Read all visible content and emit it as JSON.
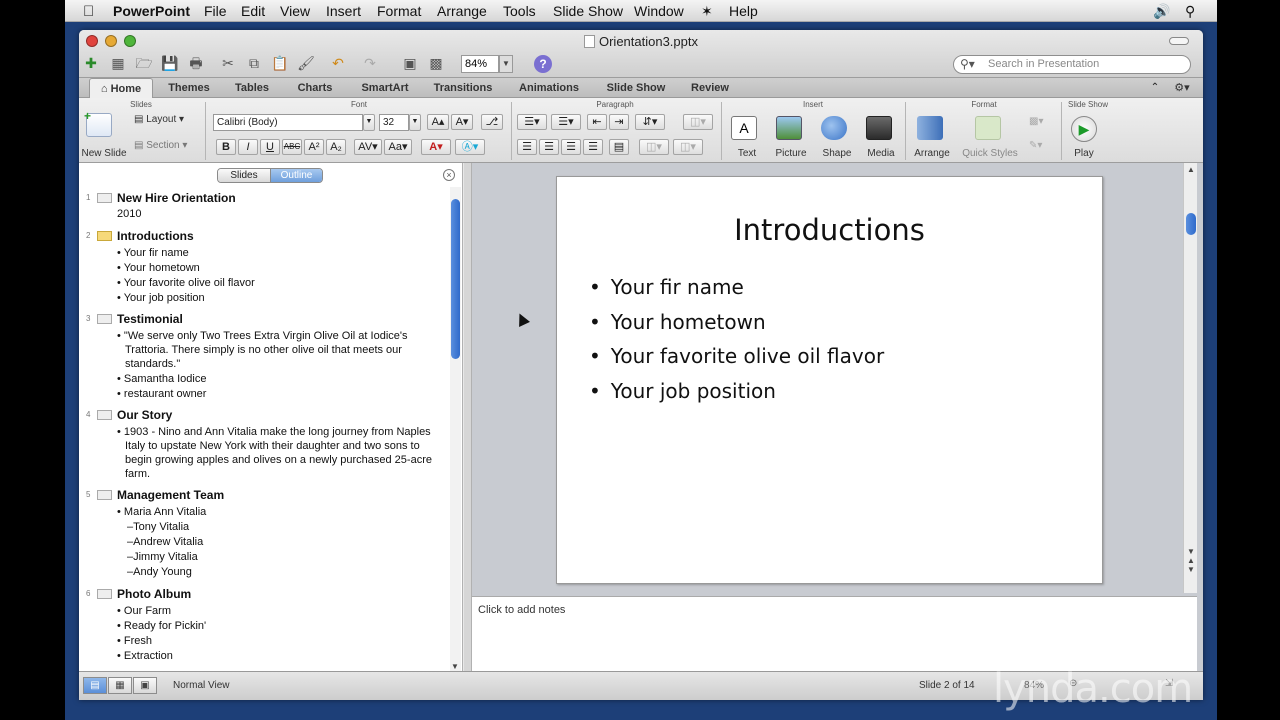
{
  "menubar": {
    "apple": "",
    "app_name": "PowerPoint",
    "items": [
      "File",
      "Edit",
      "View",
      "Insert",
      "Format",
      "Arrange",
      "Tools",
      "Slide Show",
      "Window",
      "Help"
    ]
  },
  "window": {
    "title": "Orientation3.pptx",
    "zoom": "84%",
    "search_placeholder": "Search in Presentation"
  },
  "tabs": [
    "Home",
    "Themes",
    "Tables",
    "Charts",
    "SmartArt",
    "Transitions",
    "Animations",
    "Slide Show",
    "Review"
  ],
  "ribbon": {
    "groups": {
      "slides": "Slides",
      "font": "Font",
      "paragraph": "Paragraph",
      "insert": "Insert",
      "format": "Format",
      "slideshow": "Slide Show"
    },
    "new_slide": "New Slide",
    "layout": "Layout",
    "section": "Section",
    "font_name": "Calibri (Body)",
    "font_size": "32",
    "text": "Text",
    "picture": "Picture",
    "shape": "Shape",
    "media": "Media",
    "arrange": "Arrange",
    "quick_styles": "Quick Styles",
    "play": "Play"
  },
  "pane": {
    "seg_slides": "Slides",
    "seg_outline": "Outline"
  },
  "outline": [
    {
      "num": "1",
      "title": "New Hire Orientation",
      "lines": [
        "2010"
      ],
      "bullets": []
    },
    {
      "num": "2",
      "title": "Introductions",
      "lines": [],
      "bullets": [
        "Your fir name",
        "Your hometown",
        "Your favorite olive oil flavor",
        "Your job position"
      ]
    },
    {
      "num": "3",
      "title": "Testimonial",
      "lines": [],
      "bullets": [
        "\"We serve only Two Trees Extra Virgin Olive Oil at Iodice's Trattoria. There simply is no other olive oil that meets our standards.\"",
        "Samantha Iodice",
        "restaurant owner"
      ]
    },
    {
      "num": "4",
      "title": "Our Story",
      "lines": [],
      "bullets": [
        "1903 - Nino and Ann Vitalia make the long journey from Naples Italy to upstate New York with their daughter and two sons to begin growing apples and olives on a newly purchased 25-acre farm."
      ]
    },
    {
      "num": "5",
      "title": "Management Team",
      "lines": [],
      "bullets": [
        "Maria Ann Vitalia"
      ],
      "subs": [
        "–Tony Vitalia",
        "–Andrew Vitalia",
        "–Jimmy Vitalia",
        "–Andy Young"
      ]
    },
    {
      "num": "6",
      "title": "Photo Album",
      "lines": [],
      "bullets": [
        "Our Farm",
        "Ready for Pickin'",
        "Fresh",
        "Extraction"
      ]
    }
  ],
  "slide": {
    "title": "Introductions",
    "bullets": [
      "Your fir name",
      "Your hometown",
      "Your favorite olive oil flavor",
      "Your job position"
    ]
  },
  "notes_placeholder": "Click to add notes",
  "status": {
    "view": "Normal View",
    "slide_counter": "Slide 2 of 14",
    "zoom": "84%"
  },
  "watermark": "lynda.com",
  "colors": {
    "desktop": "#1d3f78",
    "accent": "#2f6acb",
    "selected_slide_icon": "#f6d97a"
  }
}
